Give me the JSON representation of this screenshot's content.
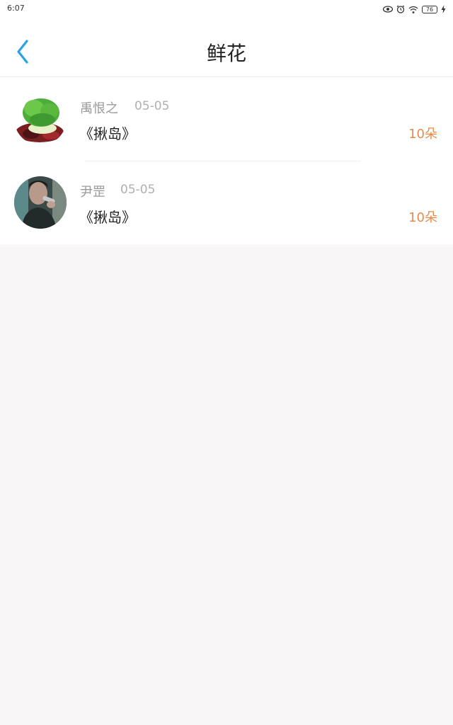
{
  "status_bar": {
    "time": "6:07",
    "battery": "76",
    "icons": [
      "eye-icon",
      "alarm-icon",
      "wifi-icon",
      "battery-icon",
      "charging-icon"
    ]
  },
  "header": {
    "back_icon": "chevron-left-icon",
    "title": "鲜花"
  },
  "list": {
    "items": [
      {
        "avatar": "lettuce-avatar",
        "name": "禹恨之",
        "date": "05-05",
        "title": "《揪岛》",
        "amount": "10朵"
      },
      {
        "avatar": "singer-avatar",
        "name": "尹罡",
        "date": "05-05",
        "title": "《揪岛》",
        "amount": "10朵"
      }
    ]
  },
  "colors": {
    "accent_blue": "#2aa3e6",
    "amount_orange": "#e88a4a",
    "page_background": "#f8f6f6"
  }
}
